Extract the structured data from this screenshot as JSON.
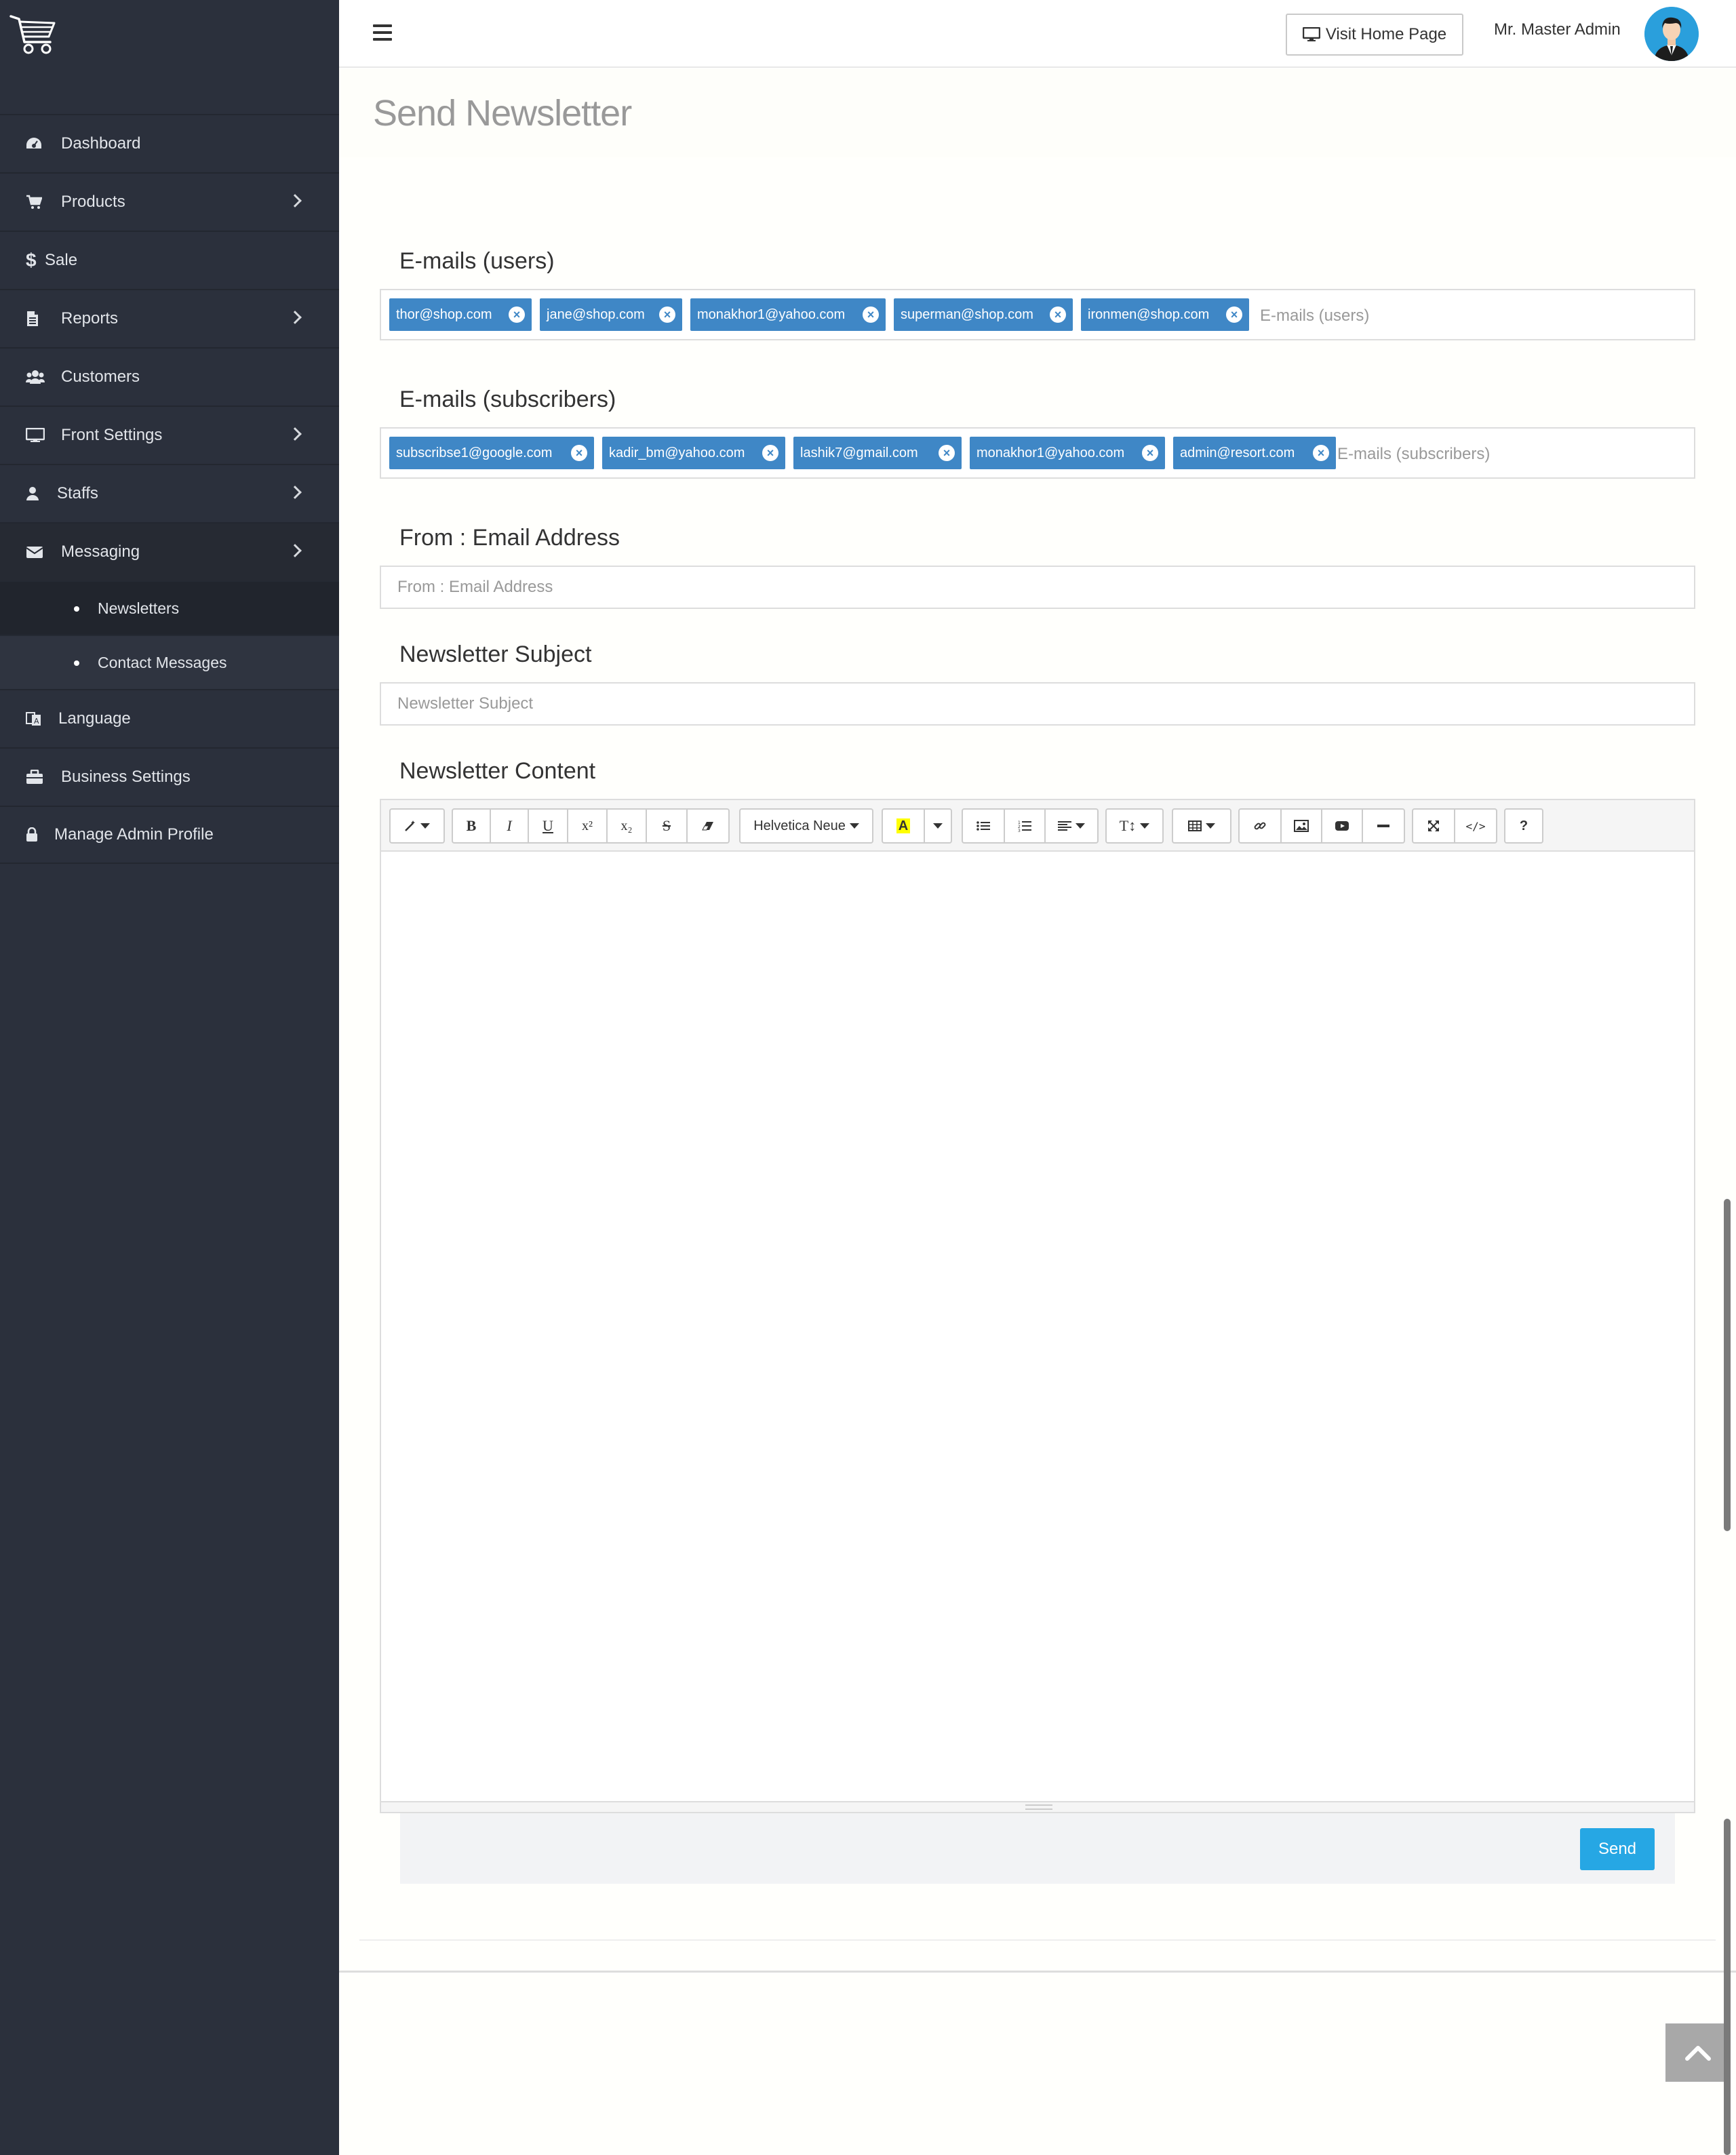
{
  "sidebar": {
    "items": [
      {
        "label": "Dashboard",
        "icon": "dashboard-icon",
        "has_children": false
      },
      {
        "label": "Products",
        "icon": "cart-icon",
        "has_children": true
      },
      {
        "label": "Sale",
        "icon": "dollar-icon",
        "has_children": false
      },
      {
        "label": "Reports",
        "icon": "file-icon",
        "has_children": true
      },
      {
        "label": "Customers",
        "icon": "users-icon",
        "has_children": false
      },
      {
        "label": "Front Settings",
        "icon": "monitor-icon",
        "has_children": true
      },
      {
        "label": "Staffs",
        "icon": "user-icon",
        "has_children": true
      },
      {
        "label": "Messaging",
        "icon": "envelope-icon",
        "has_children": true,
        "expanded": true,
        "children": [
          {
            "label": "Newsletters",
            "current": true
          },
          {
            "label": "Contact Messages"
          }
        ]
      },
      {
        "label": "Language",
        "icon": "language-icon",
        "has_children": false
      },
      {
        "label": "Business Settings",
        "icon": "briefcase-icon",
        "has_children": false
      },
      {
        "label": "Manage Admin Profile",
        "icon": "lock-icon",
        "has_children": false
      }
    ]
  },
  "header": {
    "visit_label": "Visit Home Page",
    "admin_name": "Mr. Master Admin"
  },
  "page": {
    "title": "Send Newsletter"
  },
  "form": {
    "users_label": "E-mails (users)",
    "users_tags": [
      "thor@shop.com",
      "jane@shop.com",
      "monakhor1@yahoo.com",
      "superman@shop.com",
      "ironmen@shop.com"
    ],
    "users_placeholder": "E-mails (users)",
    "subs_label": "E-mails (subscribers)",
    "subs_tags": [
      "subscribse1@google.com",
      "kadir_bm@yahoo.com",
      "lashik7@gmail.com",
      "monakhor1@yahoo.com",
      "admin@resort.com"
    ],
    "subs_placeholder": "E-mails (subscribers)",
    "from_label": "From : Email Address",
    "from_placeholder": "From : Email Address",
    "subject_label": "Newsletter Subject",
    "subject_placeholder": "Newsletter Subject",
    "content_label": "Newsletter Content",
    "font_name": "Helvetica Neue",
    "send_label": "Send"
  },
  "colors": {
    "sidebar_bg": "#2b303c",
    "tag_bg": "#3f87c6",
    "send_bg": "#26a7e4"
  }
}
